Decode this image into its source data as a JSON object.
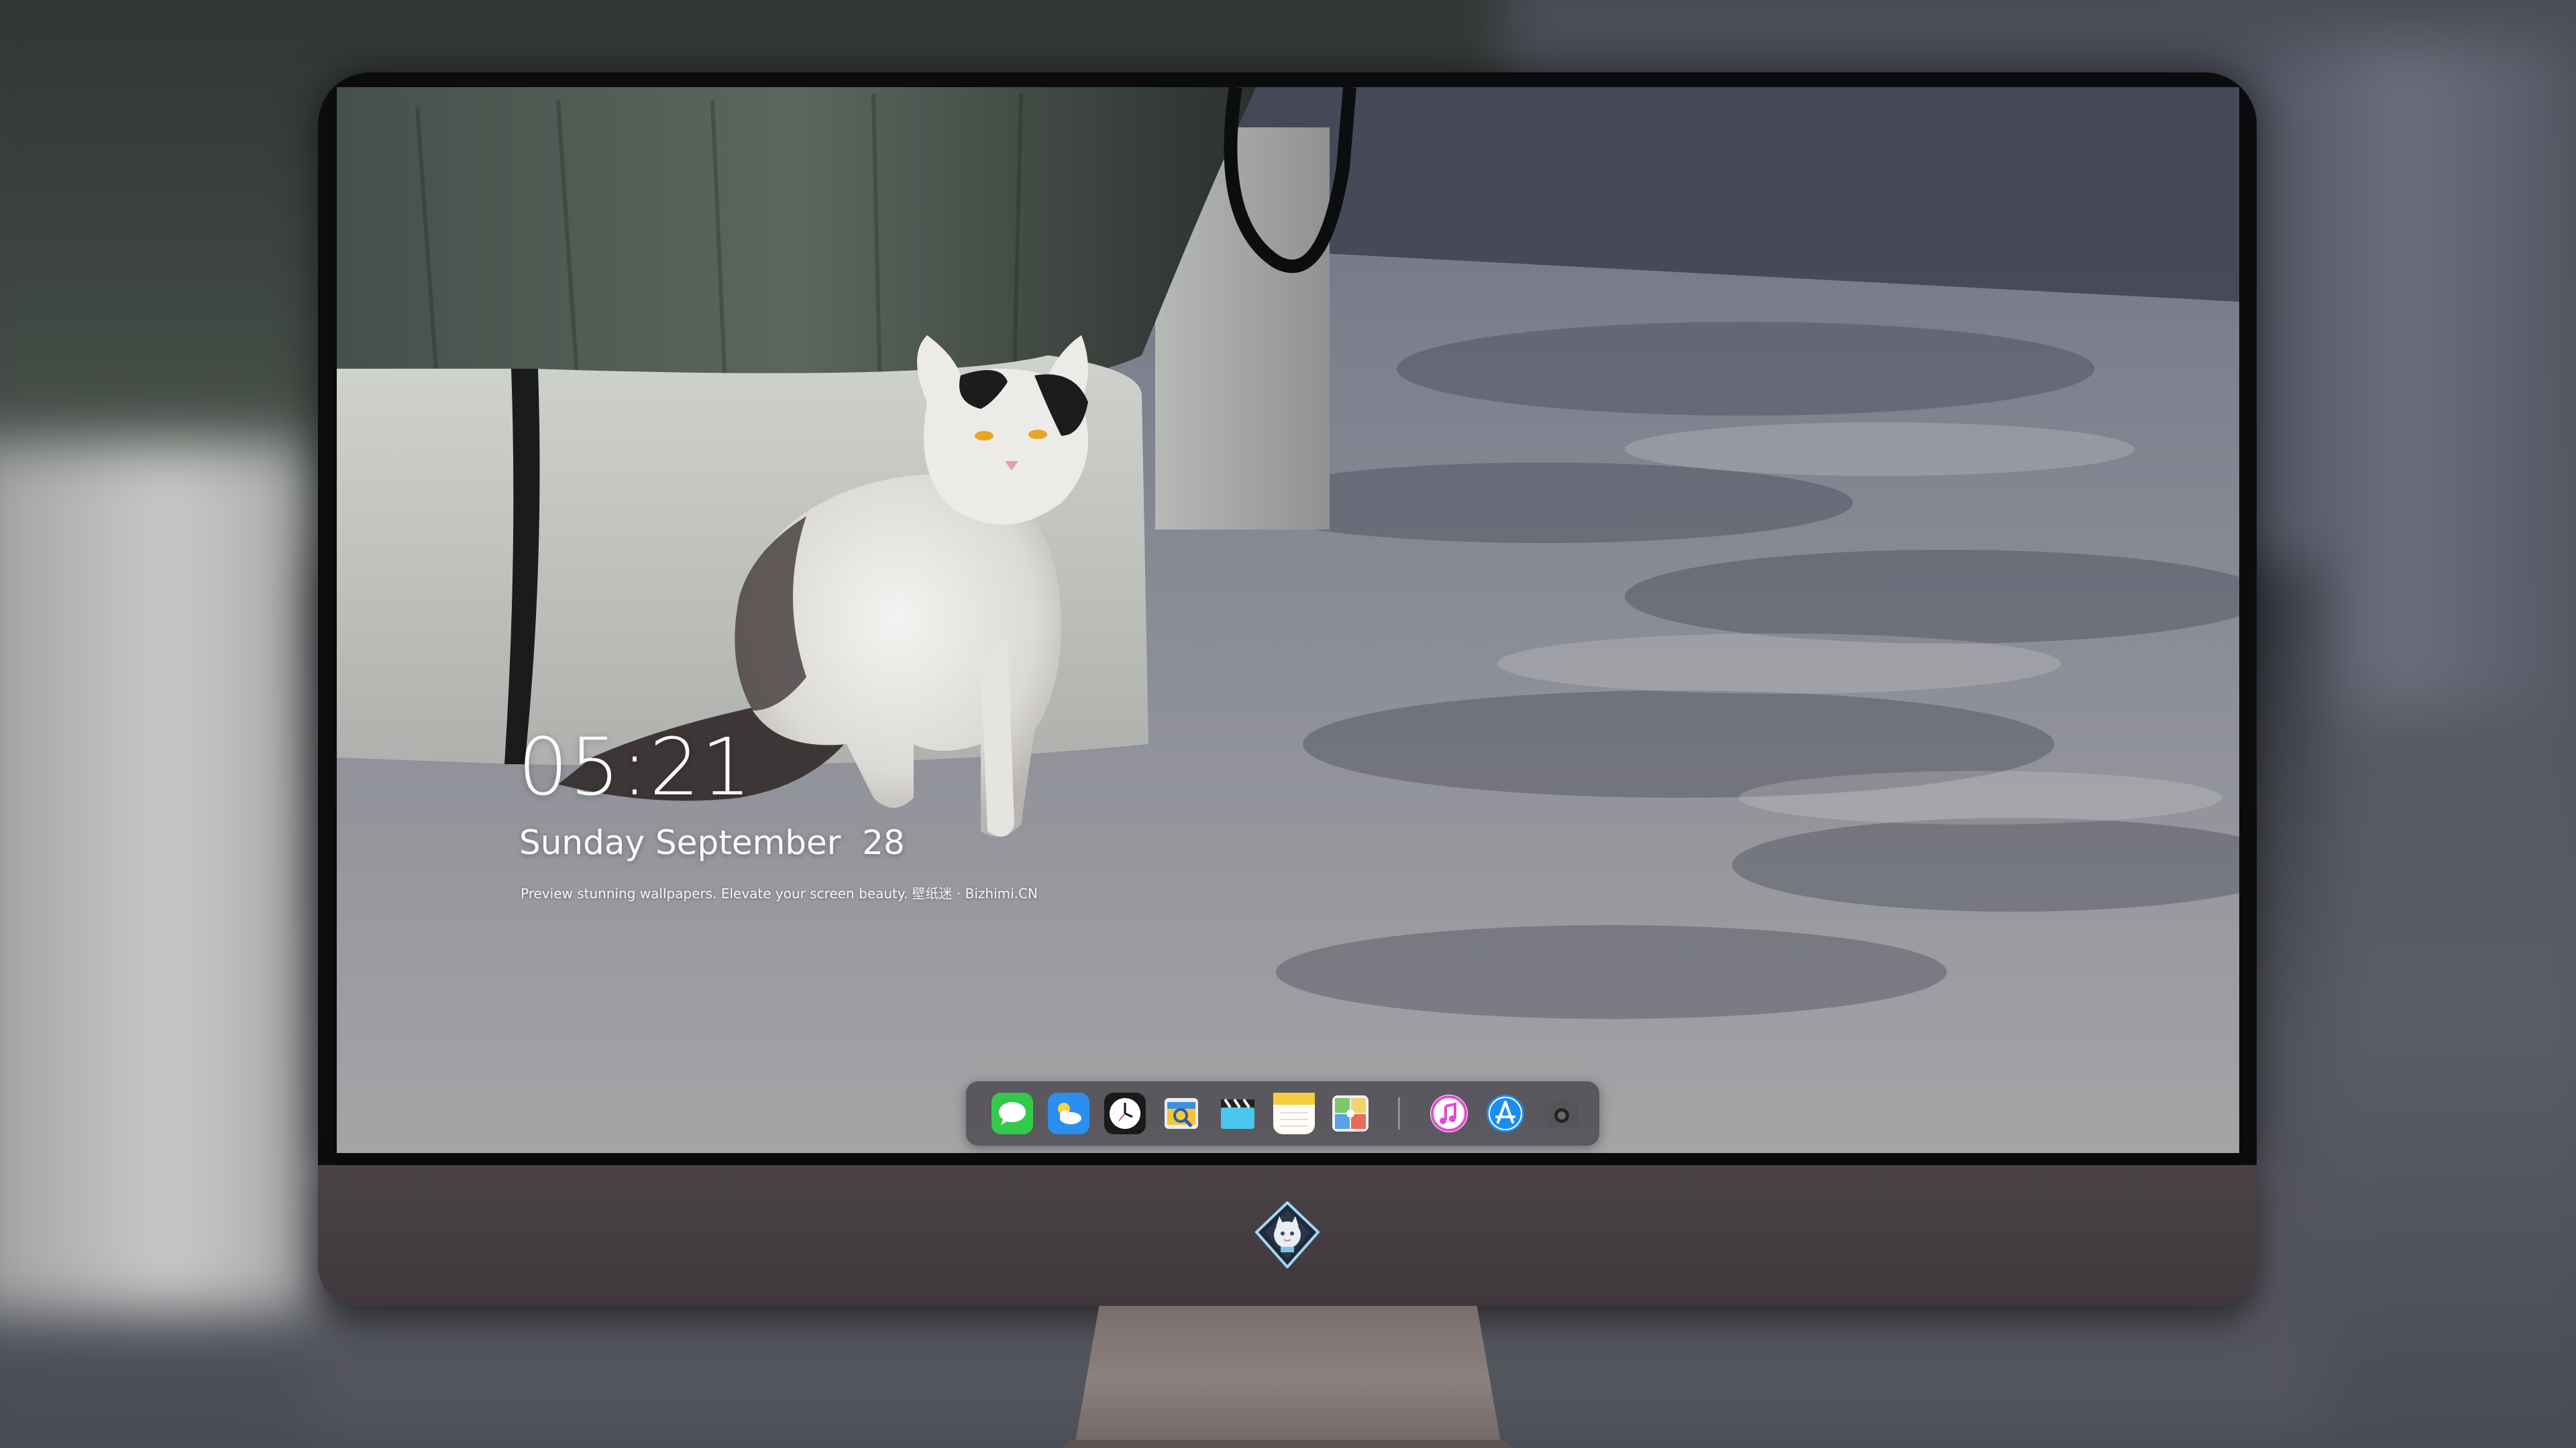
{
  "lock_screen": {
    "time": "05:21",
    "date": "Sunday September  28",
    "caption": "Preview stunning wallpapers. Elevate your screen beauty. 壁纸迷 · Bizhimi.CN"
  },
  "dock": {
    "apps": [
      {
        "name": "Messages",
        "icon": "messages-icon",
        "color": "#3ad14f"
      },
      {
        "name": "Weather",
        "icon": "weather-icon",
        "color": "#2f8cf0"
      },
      {
        "name": "Clock",
        "icon": "clock-icon",
        "color": "#1b1b1b"
      },
      {
        "name": "Preview",
        "icon": "preview-icon",
        "color": "#f0c43a"
      },
      {
        "name": "Clips",
        "icon": "clapperboard-icon",
        "color": "#46c6ea"
      },
      {
        "name": "Notes",
        "icon": "notes-icon",
        "color": "#f7d14a"
      },
      {
        "name": "Maps",
        "icon": "maps-icon",
        "color": "#6cb85a"
      },
      {
        "name": "Music",
        "icon": "music-icon",
        "color": "#e64ad5"
      },
      {
        "name": "App Store",
        "icon": "app-store-icon",
        "color": "#1d8ef2"
      },
      {
        "name": "Camera",
        "icon": "camera-icon",
        "color": "#5c5c60"
      }
    ]
  }
}
